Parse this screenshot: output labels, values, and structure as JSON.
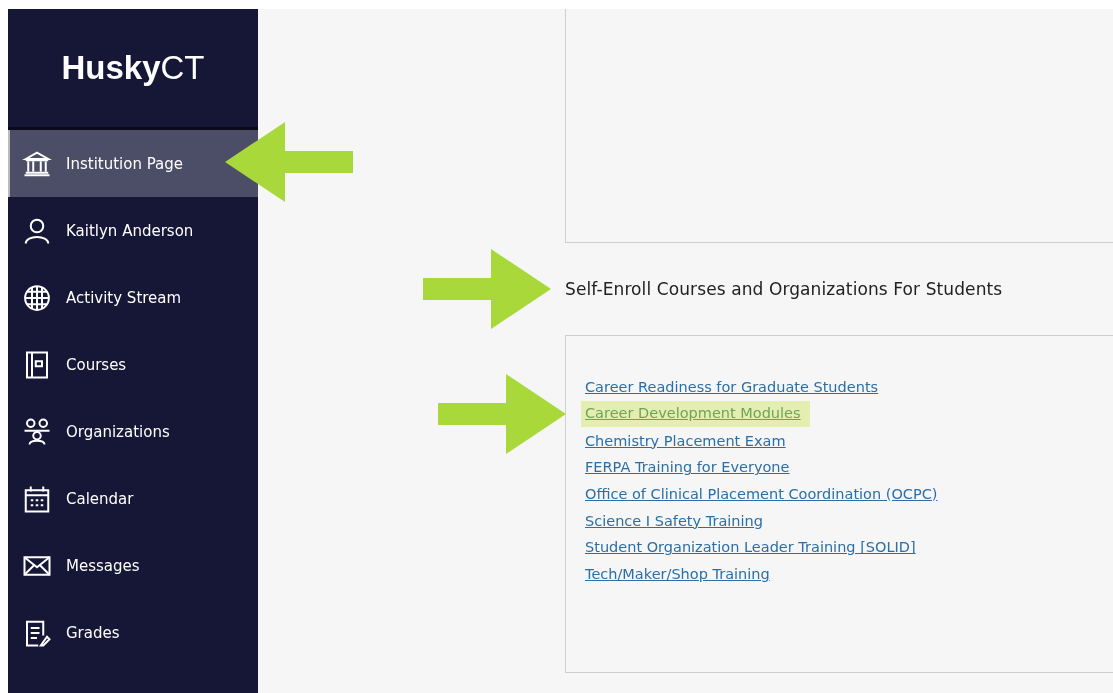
{
  "sidebar": {
    "logo": "**Husky**CT",
    "items": [
      {
        "label": "Institution Page",
        "selected": true,
        "pointed": true
      },
      {
        "label": "Kaitlyn Anderson",
        "selected": false,
        "pointed": false
      },
      {
        "label": "Activity Stream",
        "selected": false,
        "pointed": false
      },
      {
        "label": "Courses",
        "selected": false,
        "pointed": false
      },
      {
        "label": "Organizations",
        "selected": false,
        "pointed": false
      },
      {
        "label": "Calendar",
        "selected": false,
        "pointed": false
      },
      {
        "label": "Messages",
        "selected": false,
        "pointed": false
      },
      {
        "label": "Grades",
        "selected": false,
        "pointed": false
      }
    ]
  },
  "self_enroll": {
    "heading": "Self-Enroll Courses and Organizations For Students",
    "pointed": true,
    "links": [
      {
        "label": "Career Readiness for Graduate Students",
        "highlighted": false,
        "pointed": false
      },
      {
        "label": "Career Development Modules",
        "highlighted": true,
        "pointed": true
      },
      {
        "label": "Chemistry Placement Exam",
        "highlighted": false,
        "pointed": false
      },
      {
        "label": "FERPA Training for Everyone",
        "highlighted": false,
        "pointed": false
      },
      {
        "label": "Office of Clinical Placement Coordination (OCPC)",
        "highlighted": false,
        "pointed": false
      },
      {
        "label": "Science I Safety Training",
        "highlighted": false,
        "pointed": false
      },
      {
        "label": "Student Organization Leader Training [SOLID]",
        "highlighted": false,
        "pointed": false
      },
      {
        "label": "Tech/Maker/Shop Training",
        "highlighted": false,
        "pointed": false
      }
    ]
  }
}
